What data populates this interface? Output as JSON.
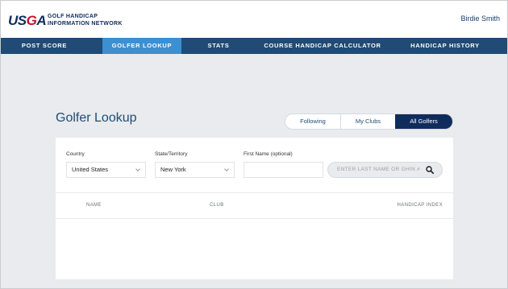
{
  "header": {
    "logo": {
      "left": "US",
      "mid": "G",
      "right": "A"
    },
    "network_line1": "GOLF HANDICAP",
    "network_line2": "INFORMATION NETWORK",
    "user_name": "Birdie Smith"
  },
  "nav": {
    "items": [
      {
        "label": "POST SCORE"
      },
      {
        "label": "GOLFER LOOKUP",
        "active": true
      },
      {
        "label": "STATS"
      },
      {
        "label": "COURSE HANDICAP CALCULATOR"
      },
      {
        "label": "HANDICAP HISTORY"
      }
    ]
  },
  "page": {
    "title": "Golfer Lookup",
    "toggle": [
      "Following",
      "My Clubs",
      "All Golfers"
    ],
    "active_toggle": "All Golfers"
  },
  "filters": {
    "country_label": "Country",
    "country_value": "United States",
    "state_label": "State/Territory",
    "state_value": "New York",
    "first_name_label": "First Name (optional)",
    "first_name_value": "",
    "search_placeholder": "ENTER LAST NAME OR GHIN #"
  },
  "table": {
    "columns": [
      "NAME",
      "CLUB",
      "HANDICAP INDEX"
    ],
    "rows": []
  },
  "colors": {
    "nav_bg": "#1f4b74",
    "nav_active": "#3c8fd1",
    "brand_navy": "#0f2c5c",
    "brand_red": "#c8102e",
    "page_bg": "#e9ebee"
  }
}
